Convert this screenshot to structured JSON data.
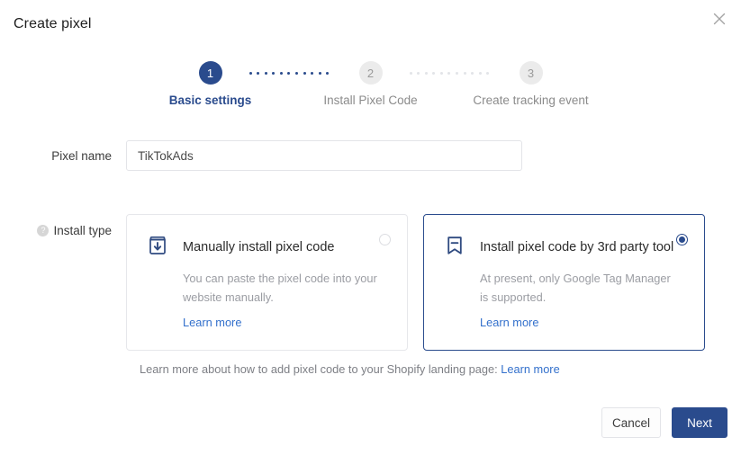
{
  "dialog": {
    "title": "Create pixel",
    "close_icon": "close-icon"
  },
  "stepper": {
    "steps": [
      {
        "number": "1",
        "label": "Basic settings",
        "state": "active"
      },
      {
        "number": "2",
        "label": "Install Pixel Code",
        "state": "inactive"
      },
      {
        "number": "3",
        "label": "Create tracking event",
        "state": "inactive"
      }
    ],
    "active_color": "#2a4b8d",
    "inactive_color": "#ebebeb"
  },
  "form": {
    "pixel_name": {
      "label": "Pixel name",
      "value": "TikTokAds",
      "placeholder": "Pixel name"
    },
    "install_type": {
      "label": "Install type",
      "help_icon": "question-mark-icon",
      "options": [
        {
          "icon": "install-box-download-icon",
          "title": "Manually install pixel code",
          "description": "You can paste the pixel code into your website manually.",
          "link": "Learn more",
          "selected": false
        },
        {
          "icon": "bookmark-minus-icon",
          "title": "Install pixel code by 3rd party tool",
          "description": "At present, only Google Tag Manager is supported.",
          "link": "Learn more",
          "selected": true
        }
      ]
    }
  },
  "footnote": {
    "text": "Learn more about how to add pixel code to your Shopify landing page:",
    "link": "Learn more"
  },
  "actions": {
    "cancel_label": "Cancel",
    "next_label": "Next",
    "primary_color": "#2a4b8d"
  }
}
